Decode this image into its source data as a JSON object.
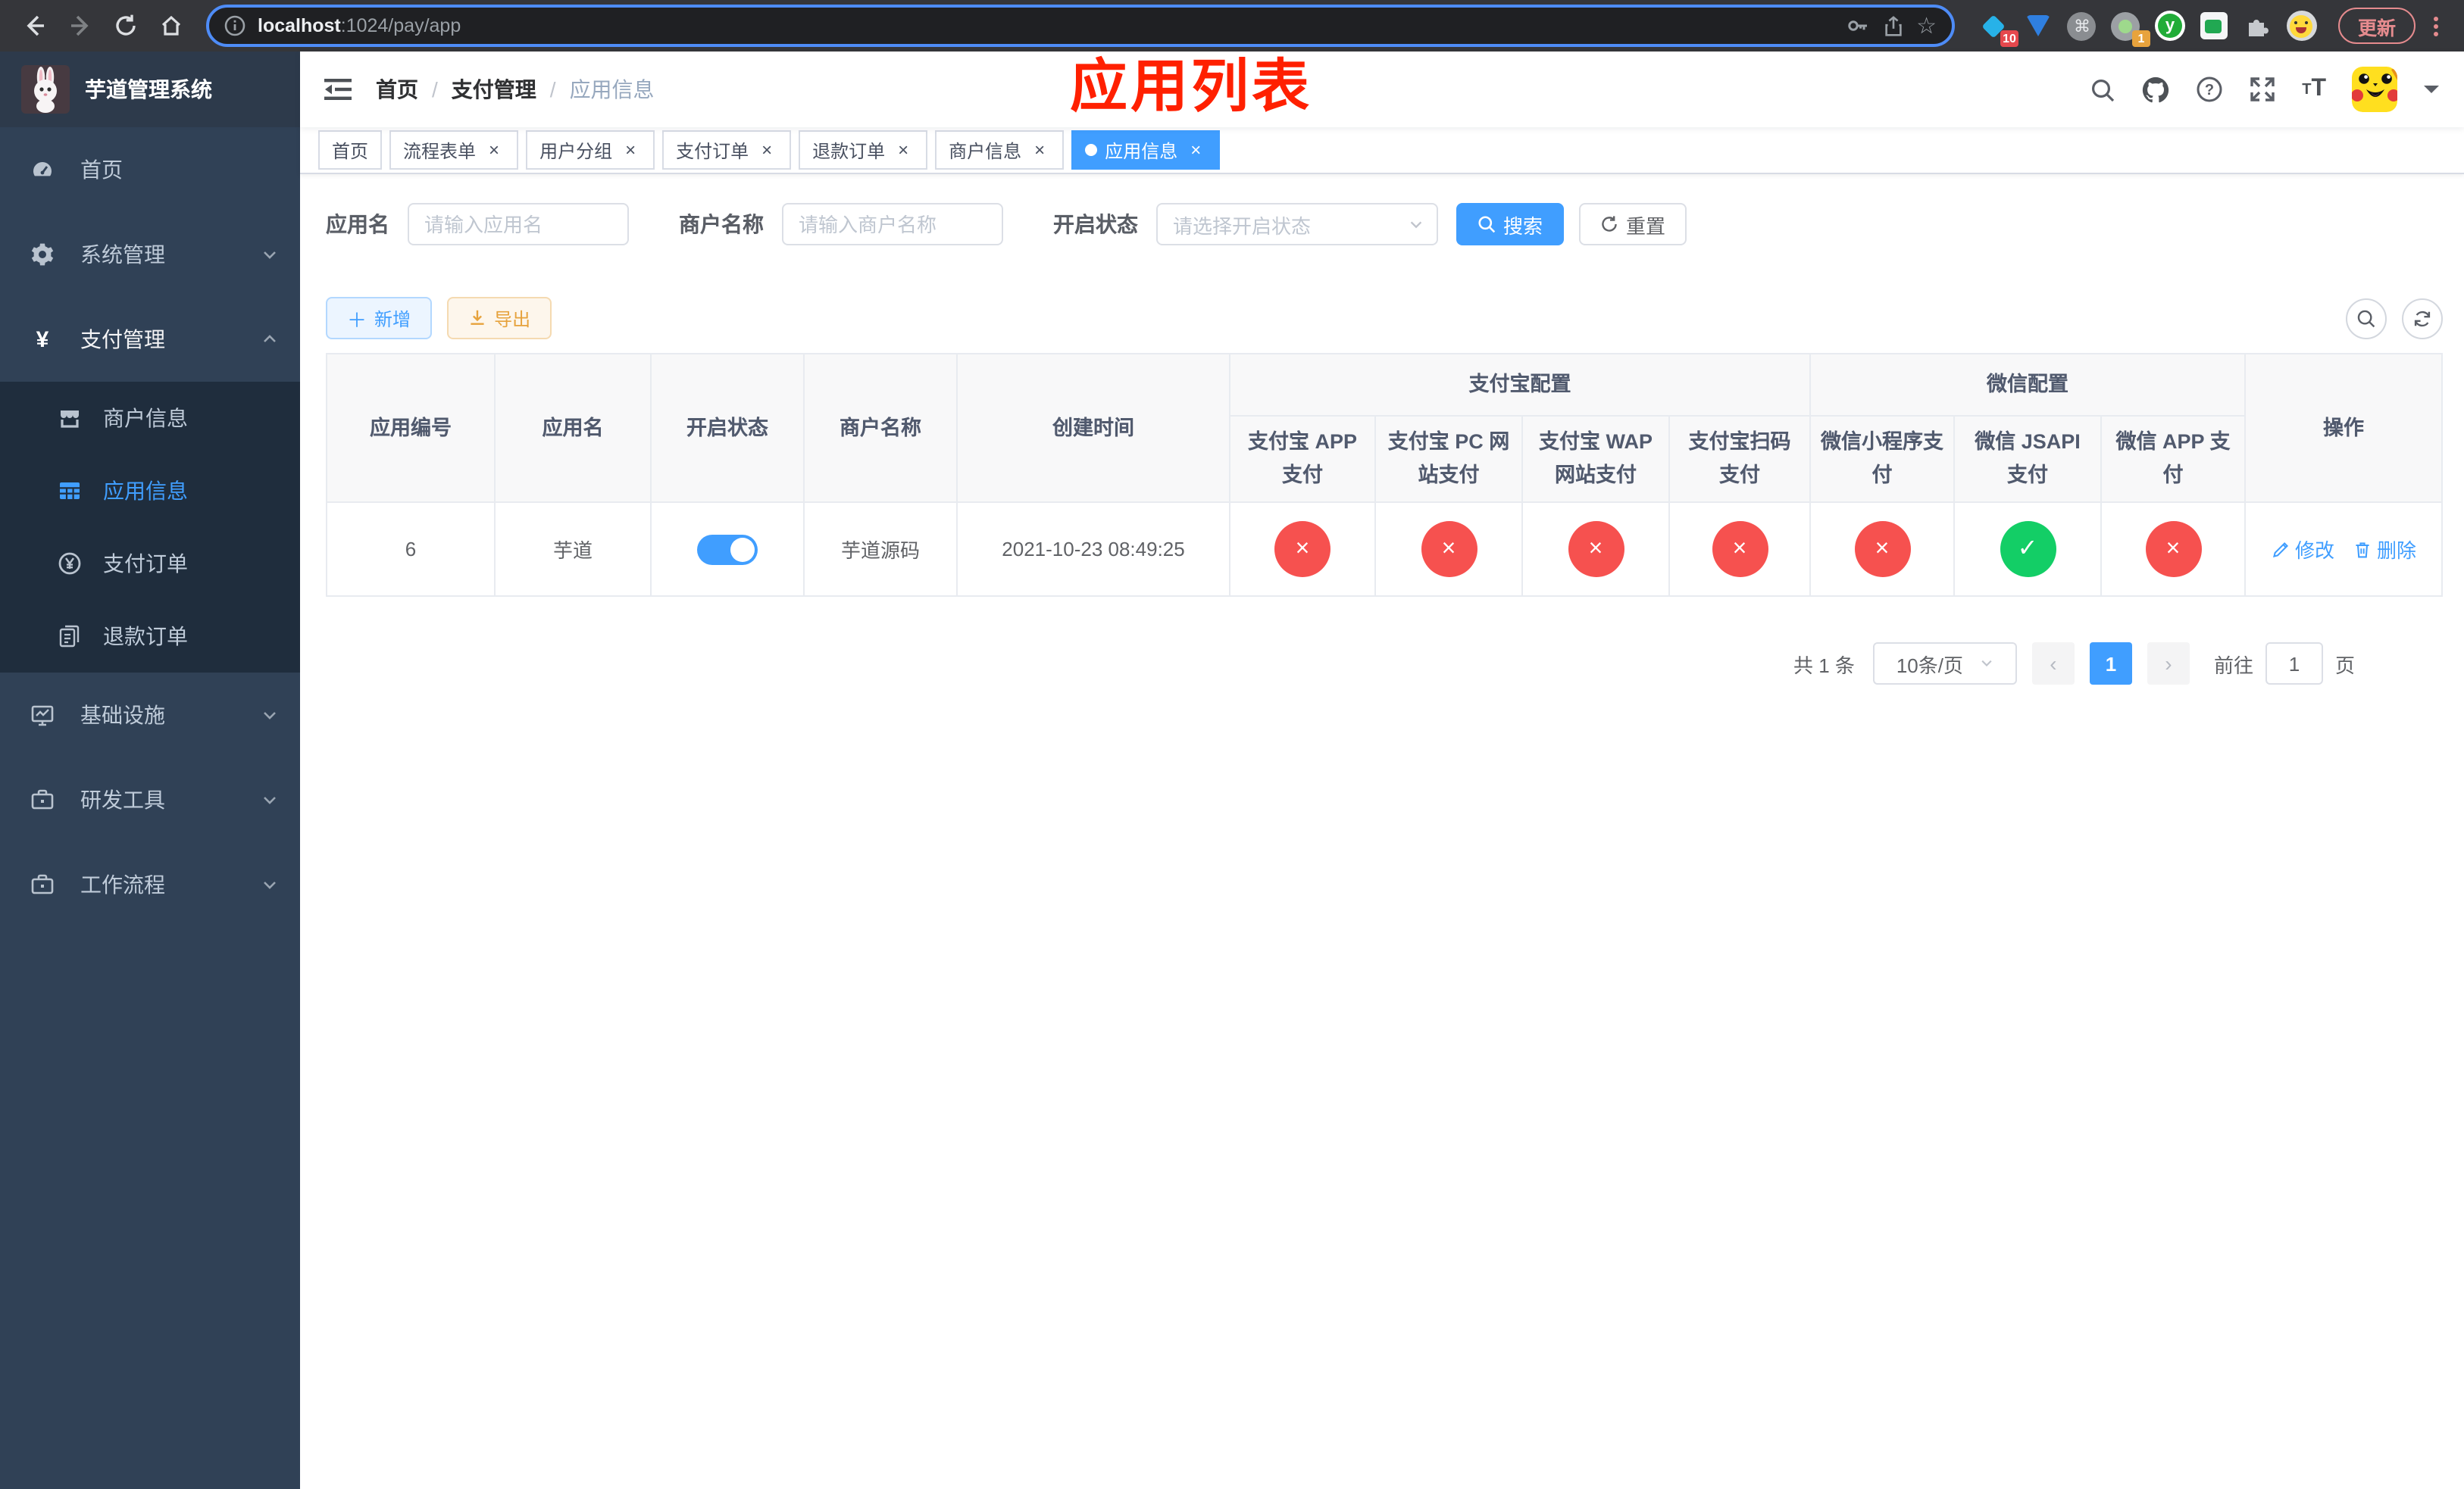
{
  "browser": {
    "url_host": "localhost",
    "url_rest": ":1024/pay/app",
    "update_label": "更新",
    "ext_badges": {
      "pin": "10",
      "recorder": "1"
    }
  },
  "sidebar": {
    "title": "芋道管理系统",
    "items": [
      {
        "label": "首页"
      },
      {
        "label": "系统管理"
      },
      {
        "label": "支付管理"
      },
      {
        "label": "基础设施"
      },
      {
        "label": "研发工具"
      },
      {
        "label": "工作流程"
      }
    ],
    "submenu": [
      {
        "label": "商户信息"
      },
      {
        "label": "应用信息"
      },
      {
        "label": "支付订单"
      },
      {
        "label": "退款订单"
      }
    ]
  },
  "navbar": {
    "breadcrumb": [
      "首页",
      "支付管理",
      "应用信息"
    ]
  },
  "annotation": {
    "text": "应用列表"
  },
  "tabs": [
    {
      "label": "首页"
    },
    {
      "label": "流程表单"
    },
    {
      "label": "用户分组"
    },
    {
      "label": "支付订单"
    },
    {
      "label": "退款订单"
    },
    {
      "label": "商户信息"
    },
    {
      "label": "应用信息"
    }
  ],
  "filters": {
    "app_name_label": "应用名",
    "app_name_placeholder": "请输入应用名",
    "merchant_label": "商户名称",
    "merchant_placeholder": "请输入商户名称",
    "status_label": "开启状态",
    "status_placeholder": "请选择开启状态",
    "search_label": "搜索",
    "reset_label": "重置"
  },
  "toolbar": {
    "add_label": "新增",
    "export_label": "导出"
  },
  "table": {
    "headers": {
      "app_id": "应用编号",
      "app_name": "应用名",
      "status": "开启状态",
      "merchant": "商户名称",
      "created": "创建时间",
      "alipay_group": "支付宝配置",
      "wechat_group": "微信配置",
      "alipay_app": "支付宝 APP 支付",
      "alipay_pc": "支付宝 PC 网站支付",
      "alipay_wap": "支付宝 WAP 网站支付",
      "alipay_qr": "支付宝扫码支付",
      "wx_lite": "微信小程序支付",
      "wx_jsapi": "微信 JSAPI 支付",
      "wx_app": "微信 APP 支付",
      "ops": "操作"
    },
    "row": {
      "app_id": "6",
      "app_name": "芋道",
      "enabled": true,
      "merchant": "芋道源码",
      "created": "2021-10-23 08:49:25",
      "pay_status": [
        false,
        false,
        false,
        false,
        false,
        true,
        false
      ],
      "edit_label": "修改",
      "delete_label": "删除"
    }
  },
  "pagination": {
    "total_label": "共 1 条",
    "per_page": "10条/页",
    "current_page": "1",
    "goto_label": "前往",
    "goto_value": "1",
    "page_suffix": "页"
  },
  "colors": {
    "accent": "#409eff",
    "success": "#13ce66",
    "danger": "#f6514f",
    "warning": "#e6a23c",
    "sidebar": "#304156"
  }
}
